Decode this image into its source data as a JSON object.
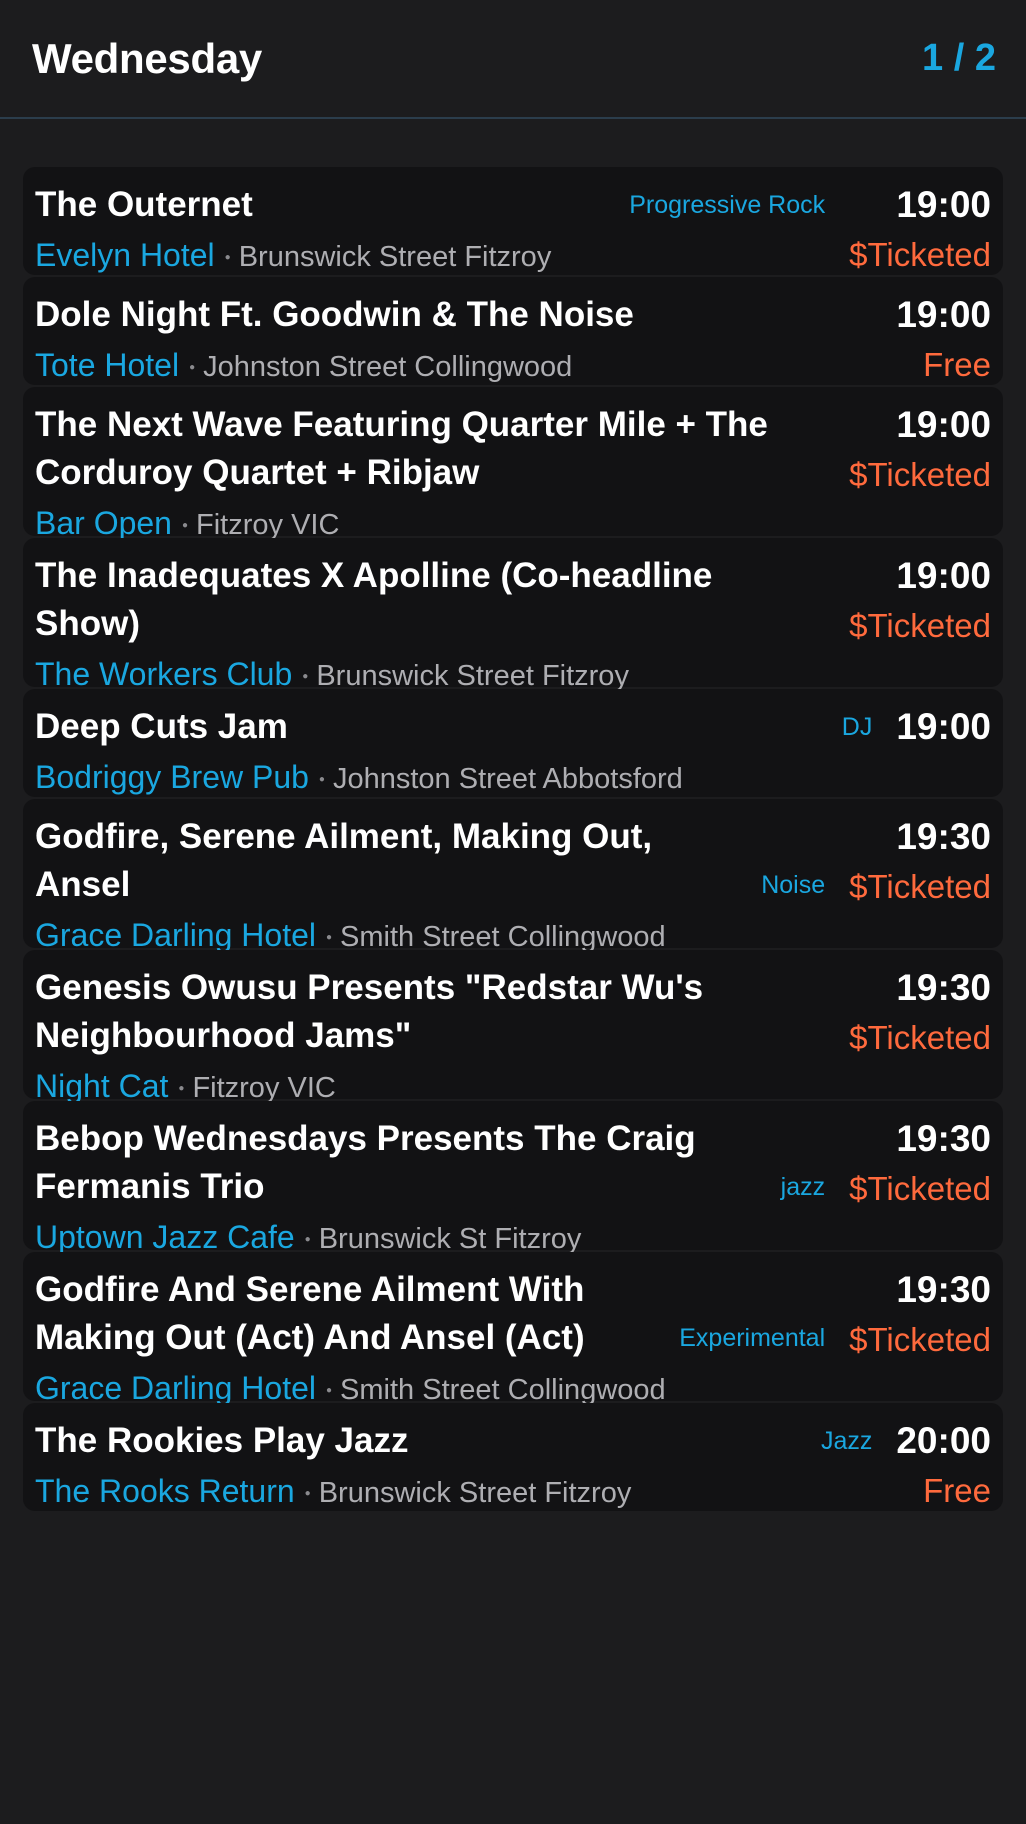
{
  "header": {
    "title": "Wednesday",
    "page": "1 / 2"
  },
  "colors": {
    "accent": "#1aa7e0",
    "price": "#ff6a3d",
    "background": "#1c1c1e",
    "card": "#121214",
    "divider": "#2b3d4c"
  },
  "events": [
    {
      "title": "The Outernet",
      "venue": "Evelyn Hotel",
      "location": "Brunswick Street Fitzroy",
      "genre": "Progressive Rock",
      "time": "19:00",
      "price": "$Ticketed"
    },
    {
      "title": "Dole Night Ft. Goodwin & The Noise",
      "venue": "Tote Hotel",
      "location": "Johnston Street Collingwood",
      "genre": "",
      "time": "19:00",
      "price": "Free"
    },
    {
      "title": "The Next Wave Featuring Quarter Mile + The Corduroy Quartet + Ribjaw",
      "venue": "Bar Open",
      "location": "Fitzroy VIC",
      "genre": "",
      "time": "19:00",
      "price": "$Ticketed"
    },
    {
      "title": "The Inadequates X Apolline (Co-headline Show)",
      "venue": "The Workers Club",
      "location": "Brunswick Street Fitzroy",
      "genre": "",
      "time": "19:00",
      "price": "$Ticketed"
    },
    {
      "title": "Deep Cuts Jam",
      "venue": "Bodriggy Brew Pub",
      "location": "Johnston Street Abbotsford",
      "genre": "DJ",
      "time": "19:00",
      "price": ""
    },
    {
      "title": "Godfire, Serene Ailment, Making Out, Ansel",
      "venue": "Grace Darling Hotel",
      "location": "Smith Street Collingwood",
      "genre": "Noise",
      "time": "19:30",
      "price": "$Ticketed"
    },
    {
      "title": "Genesis Owusu Presents \"Redstar Wu's Neighbourhood Jams\"",
      "venue": "Night Cat",
      "location": "Fitzroy VIC",
      "genre": "",
      "time": "19:30",
      "price": "$Ticketed"
    },
    {
      "title": "Bebop Wednesdays Presents The Craig Fermanis Trio",
      "venue": "Uptown Jazz Cafe",
      "location": "Brunswick St Fitzroy",
      "genre": "jazz",
      "time": "19:30",
      "price": "$Ticketed"
    },
    {
      "title": "Godfire And Serene Ailment With Making Out (Act) And Ansel (Act)",
      "venue": "Grace Darling Hotel",
      "location": "Smith Street Collingwood",
      "genre": "Experimental",
      "time": "19:30",
      "price": "$Ticketed"
    },
    {
      "title": "The Rookies Play Jazz",
      "venue": "The Rooks Return",
      "location": "Brunswick Street Fitzroy",
      "genre": "Jazz",
      "time": "20:00",
      "price": "Free"
    }
  ]
}
